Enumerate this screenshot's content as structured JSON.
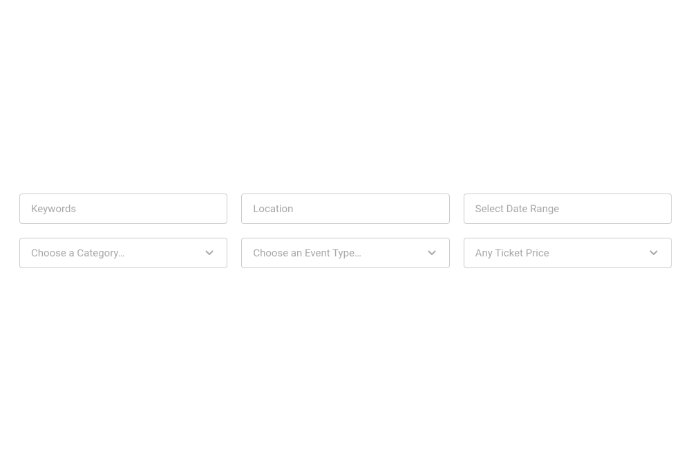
{
  "search": {
    "keywords": {
      "placeholder": "Keywords",
      "value": ""
    },
    "location": {
      "placeholder": "Location",
      "value": ""
    },
    "date_range": {
      "placeholder": "Select Date Range",
      "value": ""
    },
    "category": {
      "selected": "Choose a Category…"
    },
    "event_type": {
      "selected": "Choose an Event Type…"
    },
    "ticket_price": {
      "selected": "Any Ticket Price"
    }
  }
}
